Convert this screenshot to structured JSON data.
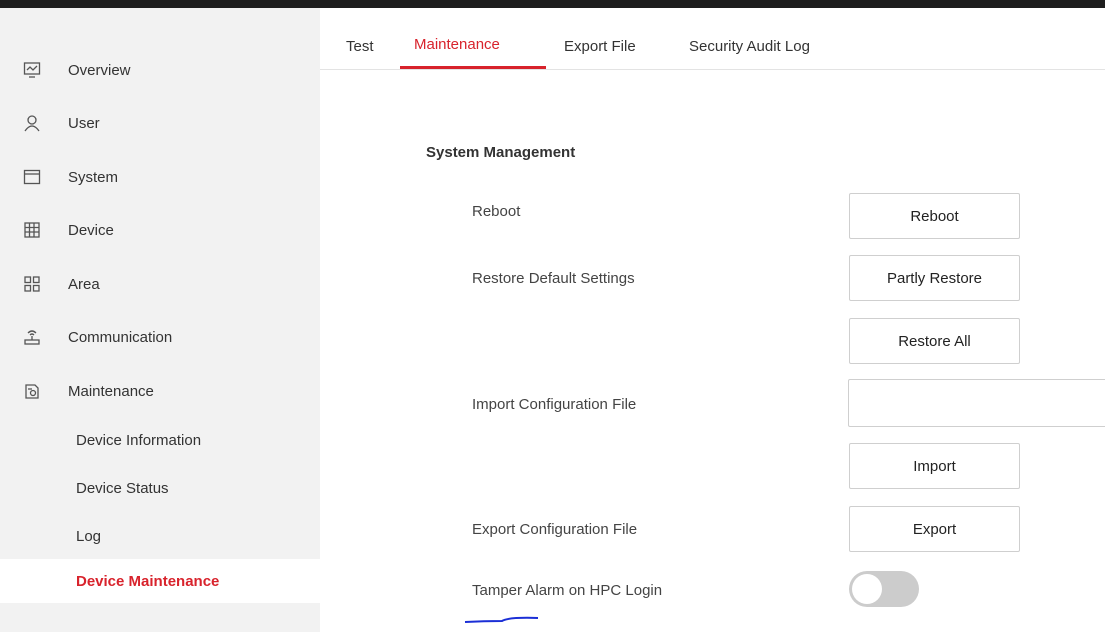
{
  "sidebar": {
    "items": [
      {
        "label": "Overview",
        "icon": "monitor-icon"
      },
      {
        "label": "User",
        "icon": "user-icon"
      },
      {
        "label": "System",
        "icon": "window-icon"
      },
      {
        "label": "Device",
        "icon": "device-icon"
      },
      {
        "label": "Area",
        "icon": "grid-icon"
      },
      {
        "label": "Communication",
        "icon": "router-icon"
      },
      {
        "label": "Maintenance",
        "icon": "maintenance-icon"
      }
    ],
    "subitems": [
      {
        "label": "Device Information"
      },
      {
        "label": "Device Status"
      },
      {
        "label": "Log"
      },
      {
        "label": "Device Maintenance",
        "active": true
      }
    ]
  },
  "tabs": [
    {
      "label": "Test"
    },
    {
      "label": "Maintenance",
      "active": true
    },
    {
      "label": "Export File"
    },
    {
      "label": "Security Audit Log"
    }
  ],
  "main": {
    "section_title": "System Management",
    "reboot_label": "Reboot",
    "reboot_button": "Reboot",
    "restore_label": "Restore Default Settings",
    "partly_restore_button": "Partly Restore",
    "restore_all_button": "Restore All",
    "import_label": "Import Configuration File",
    "import_value": "",
    "import_button": "Import",
    "export_label": "Export Configuration File",
    "export_button": "Export",
    "tamper_label": "Tamper Alarm on HPC Login",
    "tamper_enabled": false
  },
  "colors": {
    "accent": "#d8232c",
    "sidebar_bg": "#f2f2f2",
    "toggle_off": "#cccccc"
  }
}
